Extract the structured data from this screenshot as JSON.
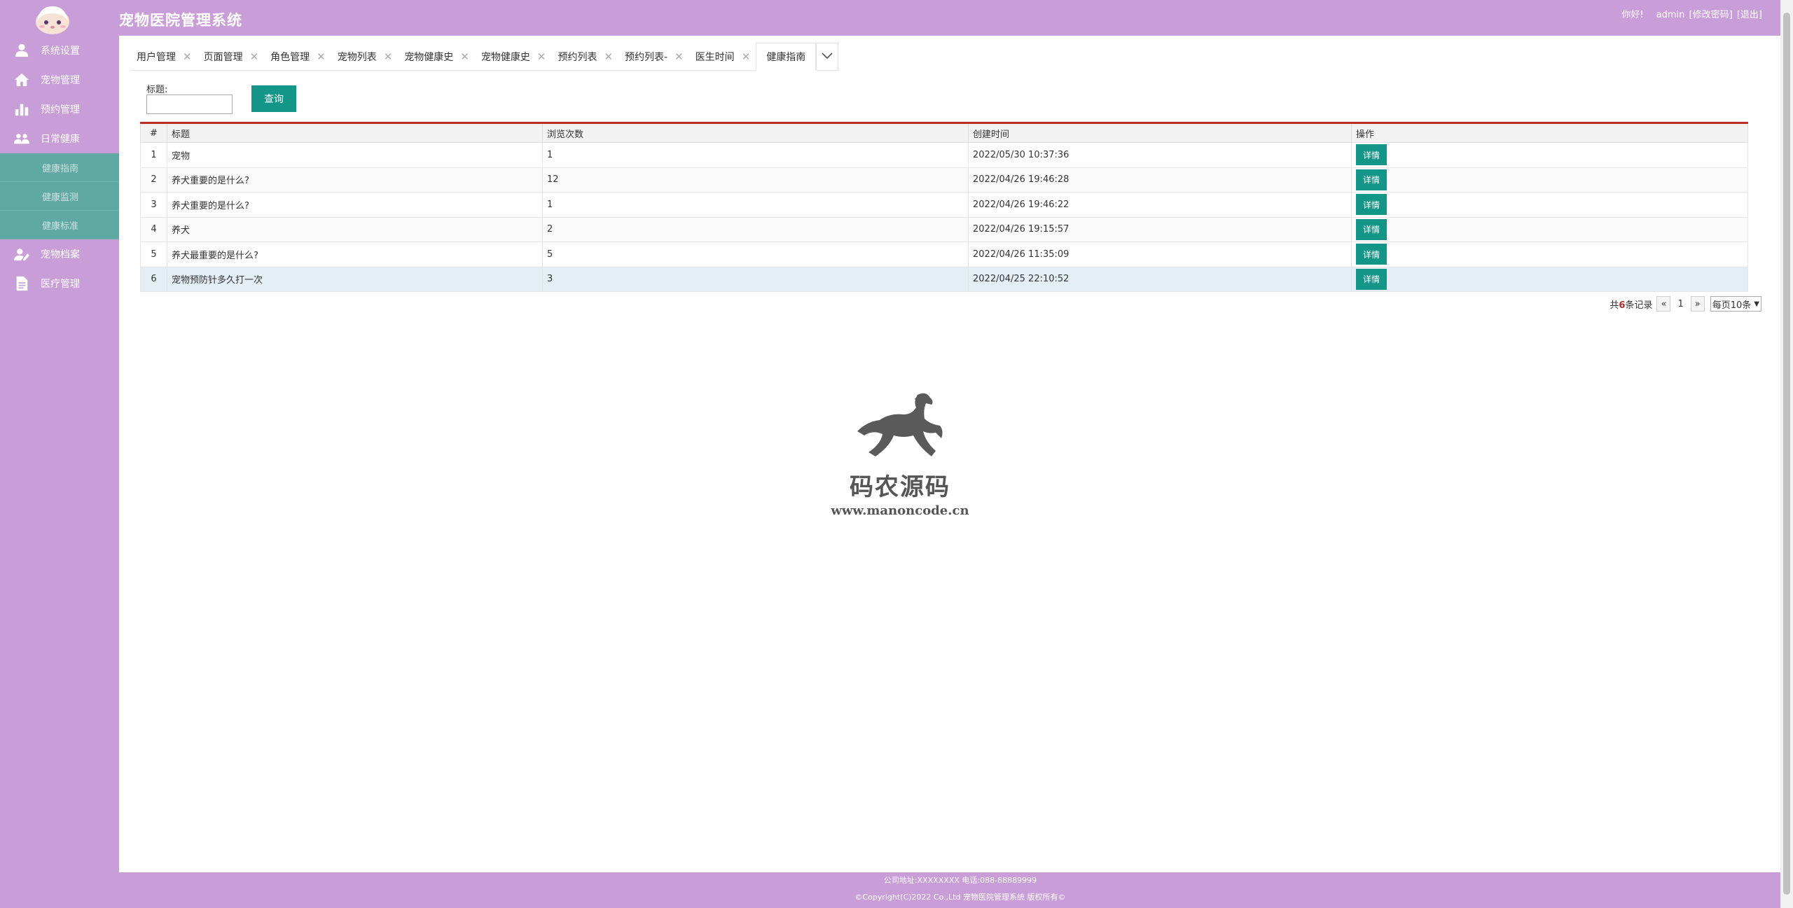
{
  "app": {
    "title": "宠物医院管理系统"
  },
  "header": {
    "greeting": "你好!",
    "username": "admin",
    "change_password": "[修改密码]",
    "logout": "[退出]"
  },
  "sidebar": {
    "items": [
      {
        "label": "系统设置",
        "icon": "user-icon"
      },
      {
        "label": "宠物管理",
        "icon": "home-icon"
      },
      {
        "label": "预约管理",
        "icon": "bar-chart-icon"
      },
      {
        "label": "日常健康",
        "icon": "group-icon"
      },
      {
        "label": "宠物档案",
        "icon": "edit-user-icon"
      },
      {
        "label": "医疗管理",
        "icon": "document-icon"
      }
    ],
    "sub_items": [
      {
        "label": "健康指南"
      },
      {
        "label": "健康监测"
      },
      {
        "label": "健康标准"
      }
    ]
  },
  "tabs": [
    {
      "label": "用户管理"
    },
    {
      "label": "页面管理"
    },
    {
      "label": "角色管理"
    },
    {
      "label": "宠物列表"
    },
    {
      "label": "宠物健康史"
    },
    {
      "label": "宠物健康史"
    },
    {
      "label": "预约列表"
    },
    {
      "label": "预约列表-"
    },
    {
      "label": "医生时间"
    },
    {
      "label": "健康指南",
      "active": true
    }
  ],
  "search": {
    "label": "标题:",
    "value": "",
    "button": "查询"
  },
  "table": {
    "headers": [
      "#",
      "标题",
      "浏览次数",
      "创建时间",
      "操作"
    ],
    "rows": [
      {
        "no": "1",
        "title": "宠物",
        "views": "1",
        "created": "2022/05/30 10:37:36",
        "action": "详情"
      },
      {
        "no": "2",
        "title": "养犬重要的是什么?",
        "views": "12",
        "created": "2022/04/26 19:46:28",
        "action": "详情"
      },
      {
        "no": "3",
        "title": "养犬重要的是什么?",
        "views": "1",
        "created": "2022/04/26 19:46:22",
        "action": "详情"
      },
      {
        "no": "4",
        "title": "养犬",
        "views": "2",
        "created": "2022/04/26 19:15:57",
        "action": "详情"
      },
      {
        "no": "5",
        "title": "养犬最重要的是什么?",
        "views": "5",
        "created": "2022/04/26 11:35:09",
        "action": "详情"
      },
      {
        "no": "6",
        "title": "宠物预防针多久打一次",
        "views": "3",
        "created": "2022/04/25 22:10:52",
        "action": "详情"
      }
    ]
  },
  "pagination": {
    "prefix": "共",
    "total": "6",
    "suffix": "条记录",
    "prev": "«",
    "page": "1",
    "next": "»",
    "page_size": "每页10条"
  },
  "watermark": {
    "text": "码农源码",
    "url": "www.manoncode.cn"
  },
  "footer": {
    "line1": "公司地址:XXXXXXXX 电话:088-88889999",
    "line2": "©Copyright(C)2022 Co.,Ltd 宠物医院管理系统 版权所有©"
  },
  "colors": {
    "brand": "#c99ed8",
    "accent": "#139688",
    "submenu": "#5fa8a3",
    "table_top_border": "#b92c28"
  }
}
